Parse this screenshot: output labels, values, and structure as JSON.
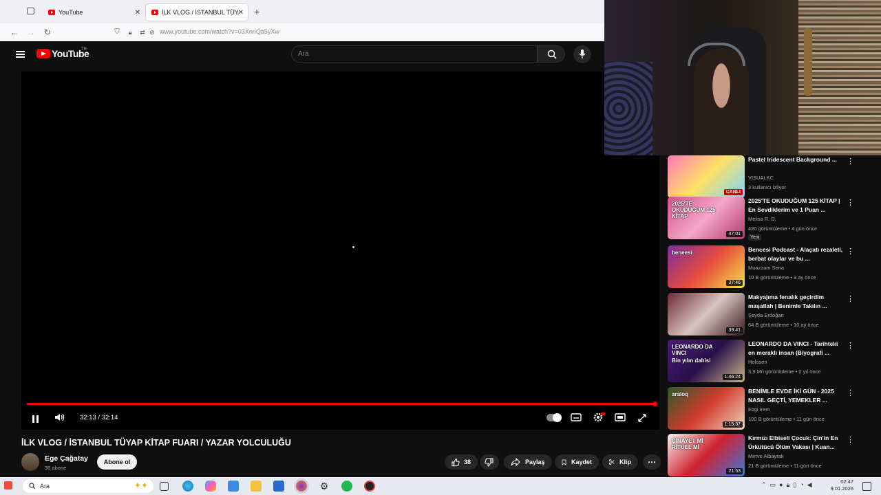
{
  "browser": {
    "tabs": [
      {
        "label": "YouTube"
      },
      {
        "label": "İLK VLOG / İSTANBUL TÜYAP Kİ"
      }
    ],
    "url": "www.youtube.com/watch?v=03XnnQa5yXw"
  },
  "youtube": {
    "logo_text": "YouTube",
    "region": "TR",
    "search_placeholder": "Ara"
  },
  "player": {
    "time": "32:13 / 32:14",
    "progress": 0.999
  },
  "video": {
    "title": "İLK VLOG / İSTANBUL TÜYAP KİTAP FUARI / YAZAR YOLCULUĞU",
    "channel": "Ege Çağatay",
    "subscribers": "35 abone",
    "subscribe_label": "Abone ol",
    "likes": "38",
    "share_label": "Paylaş",
    "save_label": "Kaydet",
    "clip_label": "Klip"
  },
  "recommendations": [
    {
      "title": "Pastel Iridescent Background ...",
      "channel": "VISUALKC",
      "meta": "3 kullanıcı izliyor",
      "duration": "",
      "live": "CANLI",
      "colors": [
        "#ff7ab6",
        "#ffe066",
        "#79d8ff"
      ]
    },
    {
      "title": "2025'TE OKUDUĞUM 125 KİTAP | En Sevdiklerim ve 1 Puan ...",
      "channel": "Melisa R. D.",
      "meta": "420 görüntüleme • 4 gün önce",
      "duration": "47:01",
      "badge": "Yeni",
      "colors": [
        "#d94f86",
        "#f3a6c8",
        "#b23a6b"
      ]
    },
    {
      "title": "Bencesi Podcast - Alaçatı rezaleti, berbat olaylar ve bu ...",
      "channel": "Muazzam Sena",
      "meta": "10 B görüntüleme • 3 ay önce",
      "duration": "37:46",
      "colors": [
        "#7a2f9e",
        "#e84a3c",
        "#f2e24a"
      ]
    },
    {
      "title": "Makyajıma fenalık geçirdim maşallah | Benimle Takılın ...",
      "channel": "Şeyda Erdoğan",
      "meta": "64 B görüntüleme • 10 ay önce",
      "duration": "39:41",
      "colors": [
        "#6b2a3a",
        "#d9c5c0",
        "#3a1a22"
      ]
    },
    {
      "title": "LEONARDO DA VINCI - Tarihteki en meraklı insan (Biyografi ...",
      "channel": "Holosen",
      "meta": "3,9 Mn görüntüleme • 2 yıl önce",
      "duration": "1:46:24",
      "colors": [
        "#4b1c78",
        "#2a0f4a",
        "#c9b48a"
      ]
    },
    {
      "title": "BENİMLE EVDE İKİ GÜN - 2025 NASIL GEÇTİ, YEMEKLER ...",
      "channel": "Ezgi İrem",
      "meta": "100 B görüntüleme • 11 gün önce",
      "duration": "1:15:37",
      "colors": [
        "#2c5a2c",
        "#d43a2c",
        "#e8d8c0"
      ]
    },
    {
      "title": "Kırmızı Elbiseli Çocuk: Çin'in En Ürkütücü Ölüm Vakası | Kuan...",
      "channel": "Merve Albayrak",
      "meta": "21 B görüntüleme • 11 gün önce",
      "duration": "21:53",
      "colors": [
        "#f2f2f2",
        "#d02030",
        "#3a7ad8"
      ]
    }
  ],
  "rec_thumb_texts": [
    "2025'TE OKUDUĞUM 125 KİTAP",
    "beneesi",
    "LEONARDO DA VINCI",
    "Bin yılın dahisi",
    "araloq",
    "CİNAYET Mİ RİTÜEL Mİ"
  ],
  "taskbar": {
    "search_text": "Ara",
    "time": "02:47",
    "date": "9.01.2026"
  }
}
